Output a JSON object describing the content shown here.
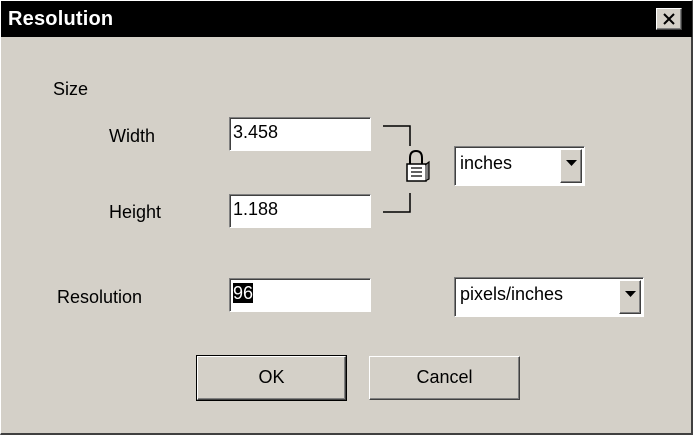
{
  "dialog": {
    "title": "Resolution",
    "close_icon": "close-icon"
  },
  "size": {
    "group_label": "Size",
    "width_label": "Width",
    "width_value": "3.458",
    "height_label": "Height",
    "height_value": "1.188",
    "unit_selected": "inches",
    "lock_icon": "lock-icon"
  },
  "resolution": {
    "label": "Resolution",
    "value": "96",
    "unit_selected": "pixels/inches"
  },
  "buttons": {
    "ok_label": "OK",
    "cancel_label": "Cancel"
  },
  "colors": {
    "face": "#d4d0c8",
    "titlebar": "#000000",
    "title_text": "#ffffff"
  }
}
